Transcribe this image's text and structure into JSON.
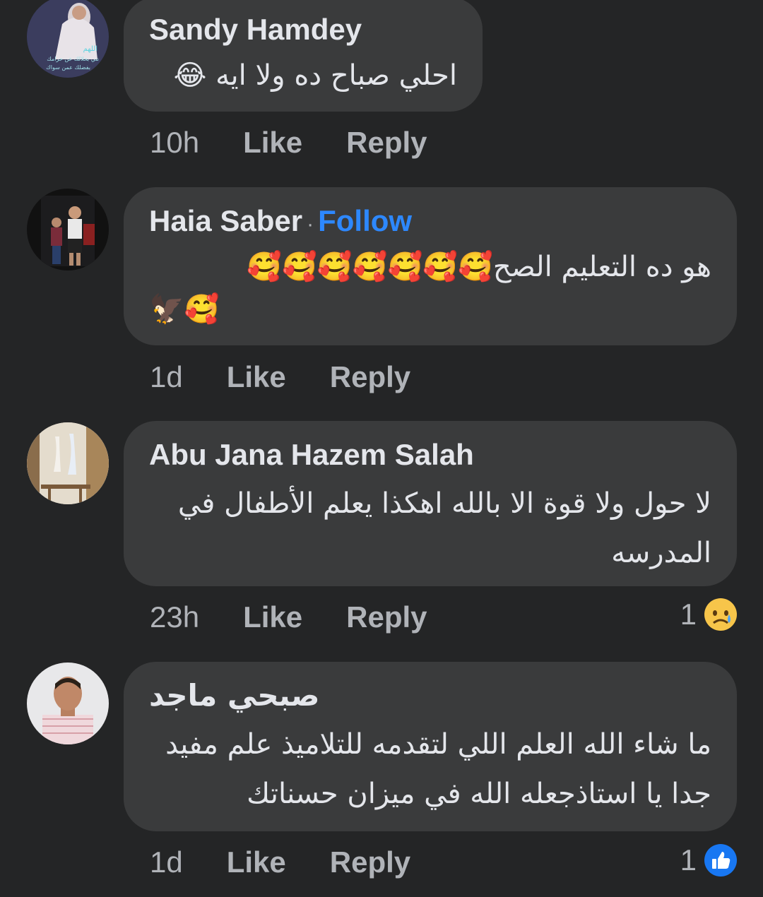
{
  "comments": [
    {
      "author": "Sandy Hamdey",
      "text": "احلي صباح ده ولا ايه 😂",
      "time": "10h",
      "like": "Like",
      "reply": "Reply",
      "avatar_text": [
        "اللهم",
        "نني بحلالك عن حرامك",
        "بفضلك عمن سواك"
      ]
    },
    {
      "author": "Haia Saber",
      "follow_sep": "·",
      "follow": "Follow",
      "text": "هو ده التعليم الصح🥰🥰🥰🥰🥰🥰🥰",
      "text2": "🦅🥰",
      "time": "1d",
      "like": "Like",
      "reply": "Reply"
    },
    {
      "author": "Abu Jana Hazem Salah",
      "text": "لا حول ولا قوة الا بالله  اهكذا يعلم الأطفال في المدرسه",
      "time": "23h",
      "like": "Like",
      "reply": "Reply",
      "reaction_count": "1",
      "reaction_icon": "sad-reaction-icon"
    },
    {
      "author": "صبحي ماجد",
      "text": "ما شاء الله العلم اللي لتقدمه للتلاميذ علم مفيد جدا يا استاذجعله الله في ميزان حسناتك",
      "time": "1d",
      "like": "Like",
      "reply": "Reply",
      "reaction_count": "1",
      "reaction_icon": "like-reaction-icon"
    }
  ],
  "colors": {
    "background": "#242526",
    "bubble": "#3a3b3c",
    "text": "#e4e6eb",
    "secondary": "#b0b3b8",
    "link": "#2d88ff"
  }
}
